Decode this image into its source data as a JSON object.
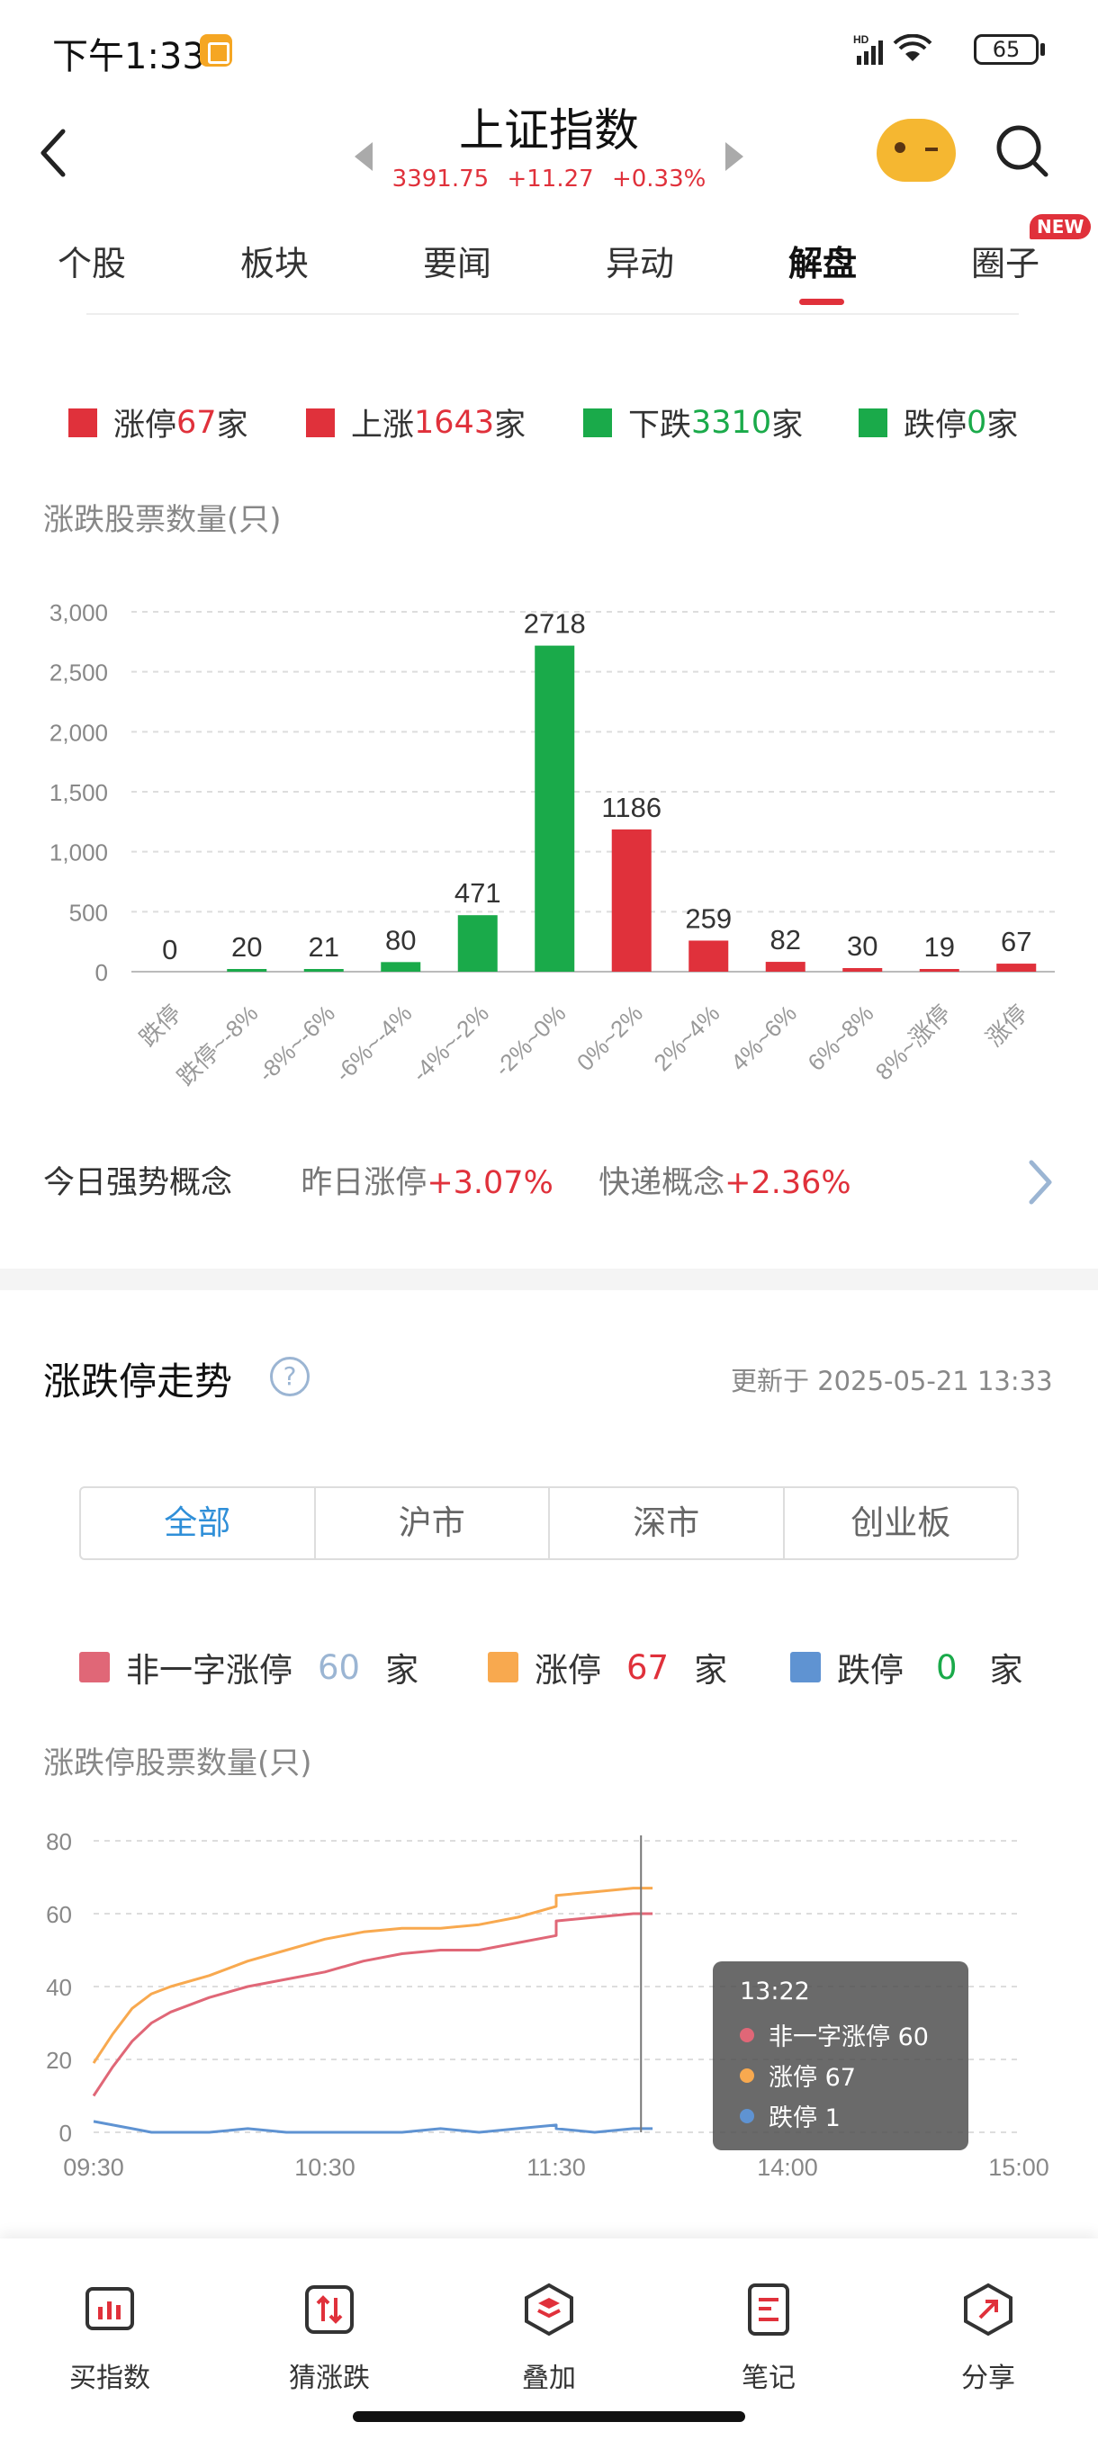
{
  "status_bar": {
    "time": "下午1:33",
    "battery": "65"
  },
  "header": {
    "title": "上证指数",
    "price": "3391.75",
    "change": "+11.27",
    "change_pct": "+0.33%"
  },
  "tabs": [
    {
      "label": "个股"
    },
    {
      "label": "板块"
    },
    {
      "label": "要闻"
    },
    {
      "label": "异动"
    },
    {
      "label": "解盘",
      "active": true
    },
    {
      "label": "圈子"
    }
  ],
  "new_badge": "NEW",
  "summary_legend": [
    {
      "label": "涨停",
      "count": "67",
      "unit": "家",
      "color": "#e0313b"
    },
    {
      "label": "上涨",
      "count": "1643",
      "unit": "家",
      "color": "#e0313b"
    },
    {
      "label": "下跌",
      "count": "3310",
      "unit": "家",
      "color": "#1aaa4a"
    },
    {
      "label": "跌停",
      "count": "0",
      "unit": "家",
      "color": "#1aaa4a"
    }
  ],
  "chart_data": [
    {
      "type": "bar",
      "ylabel": "涨跌股票数量(只)",
      "ylim": [
        0,
        3000
      ],
      "yticks": [
        "0",
        "500",
        "1,000",
        "1,500",
        "2,000",
        "2,500",
        "3,000"
      ],
      "categories": [
        "跌停",
        "跌停~-8%",
        "-8%~-6%",
        "-6%~-4%",
        "-4%~-2%",
        "-2%~0%",
        "0%~2%",
        "2%~4%",
        "4%~6%",
        "6%~8%",
        "8%~涨停",
        "涨停"
      ],
      "values": [
        0,
        20,
        21,
        80,
        471,
        2718,
        1186,
        259,
        82,
        30,
        19,
        67
      ],
      "colors": [
        "#1aaa4a",
        "#1aaa4a",
        "#1aaa4a",
        "#1aaa4a",
        "#1aaa4a",
        "#1aaa4a",
        "#e0313b",
        "#e0313b",
        "#e0313b",
        "#e0313b",
        "#e0313b",
        "#e0313b"
      ],
      "grid": true
    },
    {
      "type": "line",
      "ylabel": "涨跌停股票数量(只)",
      "ylim": [
        0,
        80
      ],
      "yticks": [
        "0",
        "20",
        "40",
        "60",
        "80"
      ],
      "xticks": [
        "09:30",
        "10:30",
        "11:30",
        "14:00",
        "15:00"
      ],
      "grid": true,
      "series": [
        {
          "name": "非一字涨停",
          "color": "#e06777",
          "x": [
            "09:30",
            "09:35",
            "09:40",
            "09:45",
            "09:50",
            "10:00",
            "10:10",
            "10:20",
            "10:30",
            "10:40",
            "10:50",
            "11:00",
            "11:10",
            "11:20",
            "11:30",
            "13:00",
            "13:10",
            "13:20",
            "13:25"
          ],
          "values": [
            10,
            18,
            25,
            30,
            33,
            37,
            40,
            42,
            44,
            47,
            49,
            50,
            50,
            52,
            54,
            58,
            59,
            60,
            60
          ]
        },
        {
          "name": "涨停",
          "color": "#f8a94f",
          "x": [
            "09:30",
            "09:35",
            "09:40",
            "09:45",
            "09:50",
            "10:00",
            "10:10",
            "10:20",
            "10:30",
            "10:40",
            "10:50",
            "11:00",
            "11:10",
            "11:20",
            "11:30",
            "13:00",
            "13:10",
            "13:20",
            "13:25"
          ],
          "values": [
            19,
            27,
            34,
            38,
            40,
            43,
            47,
            50,
            53,
            55,
            56,
            56,
            57,
            59,
            62,
            65,
            66,
            67,
            67
          ]
        },
        {
          "name": "跌停",
          "color": "#5f93d2",
          "x": [
            "09:30",
            "09:35",
            "09:40",
            "09:45",
            "09:50",
            "10:00",
            "10:10",
            "10:20",
            "10:30",
            "10:40",
            "10:50",
            "11:00",
            "11:10",
            "11:20",
            "11:30",
            "13:00",
            "13:10",
            "13:20",
            "13:25"
          ],
          "values": [
            3,
            2,
            1,
            0,
            0,
            0,
            1,
            0,
            0,
            0,
            0,
            1,
            0,
            1,
            2,
            1,
            0,
            1,
            1
          ]
        }
      ],
      "cursor_time": "13:22"
    }
  ],
  "concept": {
    "label": "今日强势概念",
    "items": [
      {
        "name": "昨日涨停",
        "value": "+3.07%"
      },
      {
        "name": "快递概念",
        "value": "+2.36%"
      }
    ]
  },
  "trend_section": {
    "title": "涨跌停走势",
    "help": "?",
    "updated": "更新于 2025-05-21 13:33",
    "segments": [
      "全部",
      "沪市",
      "深市",
      "创业板"
    ],
    "legend": [
      {
        "label": "非一字涨停",
        "count": "60",
        "unit": "家",
        "color": "#e06777",
        "count_color": "#9bb5d3"
      },
      {
        "label": "涨停",
        "count": "67",
        "unit": "家",
        "color": "#f8a94f",
        "count_color": "#e0313b"
      },
      {
        "label": "跌停",
        "count": "0",
        "unit": "家",
        "color": "#5f93d2",
        "count_color": "#1aaa4a"
      }
    ],
    "tooltip": {
      "time": "13:22",
      "rows": [
        {
          "label": "非一字涨停 60",
          "color": "#e06777"
        },
        {
          "label": "涨停 67",
          "color": "#f8a94f"
        },
        {
          "label": "跌停 1",
          "color": "#5f93d2"
        }
      ]
    }
  },
  "bottom_nav": [
    {
      "label": "买指数",
      "icon": "buy-index-icon"
    },
    {
      "label": "猜涨跌",
      "icon": "guess-icon"
    },
    {
      "label": "叠加",
      "icon": "overlay-icon"
    },
    {
      "label": "笔记",
      "icon": "notes-icon"
    },
    {
      "label": "分享",
      "icon": "share-icon"
    }
  ]
}
